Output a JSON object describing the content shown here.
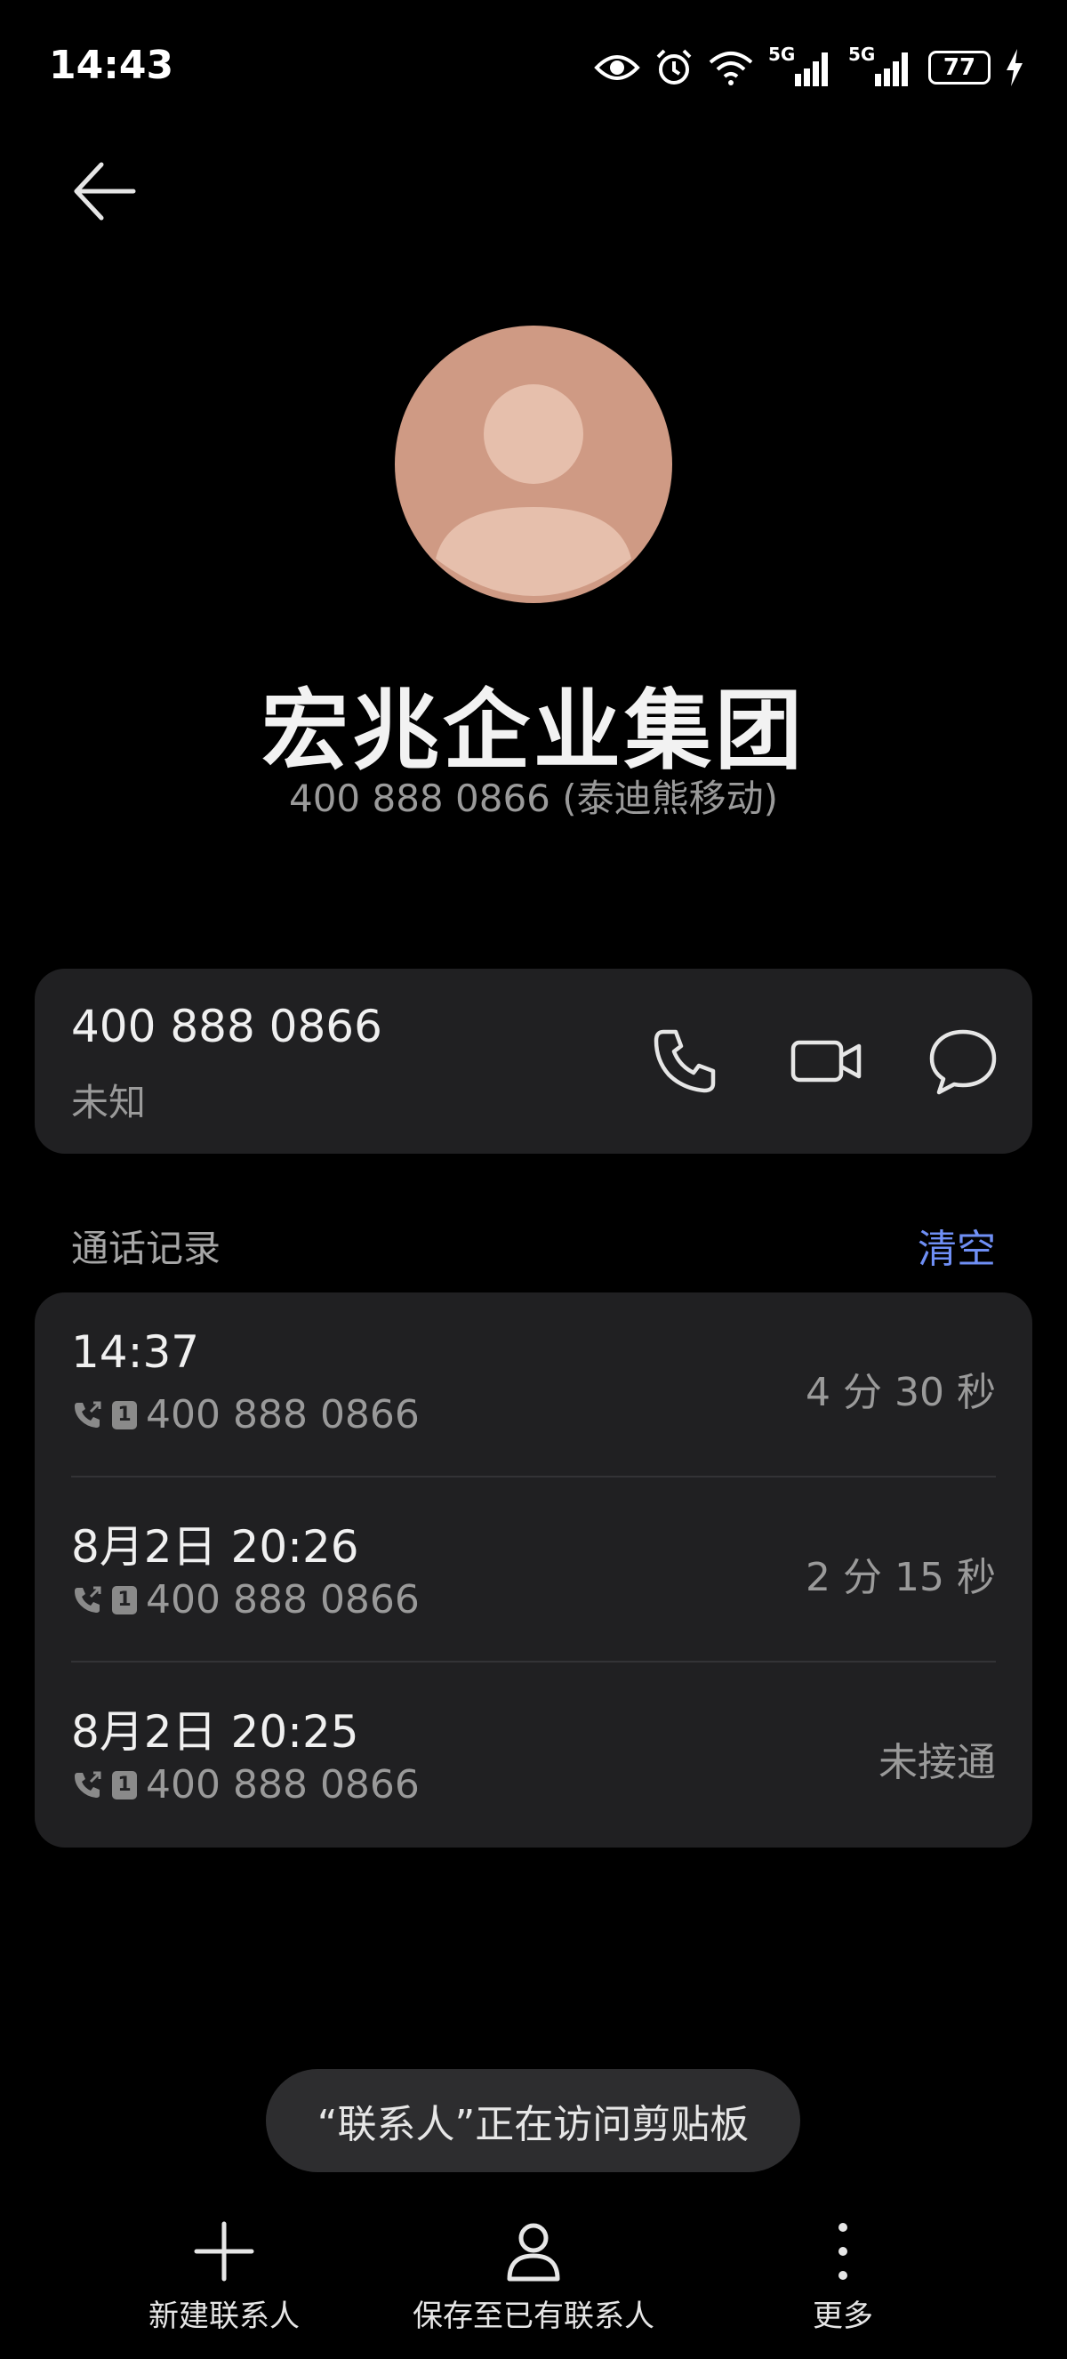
{
  "status_bar": {
    "time": "14:43",
    "signal_label_1": "5G",
    "signal_label_2": "5G",
    "battery": "77"
  },
  "contact": {
    "name": "宏兆企业集团",
    "subtitle": "400 888 0866 (泰迪熊移动)",
    "avatar_color": "#cf9a84"
  },
  "number_card": {
    "number": "400 888 0866",
    "label": "未知"
  },
  "call_log": {
    "title": "通话记录",
    "clear_label": "清空",
    "entries": [
      {
        "time": "14:37",
        "sim": "1",
        "number": "400 888 0866",
        "duration": "4 分 30 秒"
      },
      {
        "time": "8月2日 20:26",
        "sim": "1",
        "number": "400 888 0866",
        "duration": "2 分 15 秒"
      },
      {
        "time": "8月2日 20:25",
        "sim": "1",
        "number": "400 888 0866",
        "duration": "未接通"
      }
    ]
  },
  "toast": "“联系人”正在访问剪贴板",
  "bottom_bar": {
    "new_contact": "新建联系人",
    "save_existing": "保存至已有联系人",
    "more": "更多"
  },
  "colors": {
    "background": "#000000",
    "card": "#202022",
    "accent": "#6f8ff5"
  }
}
